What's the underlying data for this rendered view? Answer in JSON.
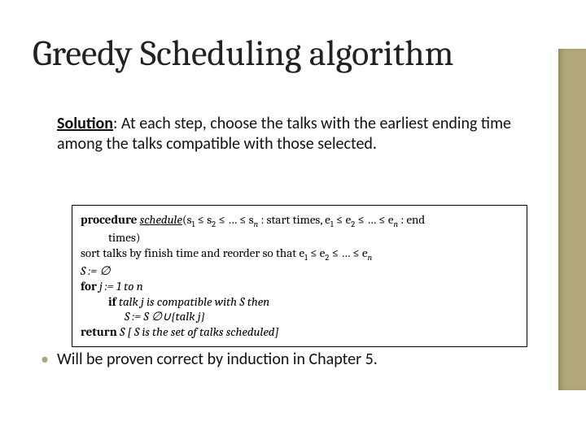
{
  "title": "Greedy Scheduling algorithm",
  "solution": {
    "label": "Solution",
    "text": ": At each step, choose the talks with the earliest ending time among the talks compatible with those selected."
  },
  "algo": {
    "l1_kw": "procedure ",
    "l1_name": "schedule",
    "l1_args": "(s",
    "l1_sub1": "1",
    "l1_rest1": " ≤ s",
    "l1_sub2": "2",
    "l1_rest2": " ≤ … ≤ s",
    "l1_subn": "n",
    "l1_rest3": " : start times, e",
    "l1_esub1": "1",
    "l1_rest4": " ≤ e",
    "l1_esub2": "2",
    "l1_rest5": " ≤ … ≤ e",
    "l1_esubn": "n",
    "l1_rest6": " : end",
    "l1b": "times)",
    "l2a": "sort talks by finish time and reorder so that e",
    "l2_sub1": "1",
    "l2b": " ≤ e",
    "l2_sub2": "2",
    "l2c": " ≤ … ≤ e",
    "l2_subn": "n",
    "l3": "S := ∅",
    "l4_kw": "for ",
    "l4_rest": "j := 1 to n",
    "l5_kw": "if ",
    "l5_rest": "talk j is compatible with S then",
    "l6": "S := S ∅∪{talk j}",
    "l7_kw": "return ",
    "l7_rest": "S  [ S is the set of talks scheduled]"
  },
  "bullet": "Will be proven correct by induction in Chapter 5."
}
